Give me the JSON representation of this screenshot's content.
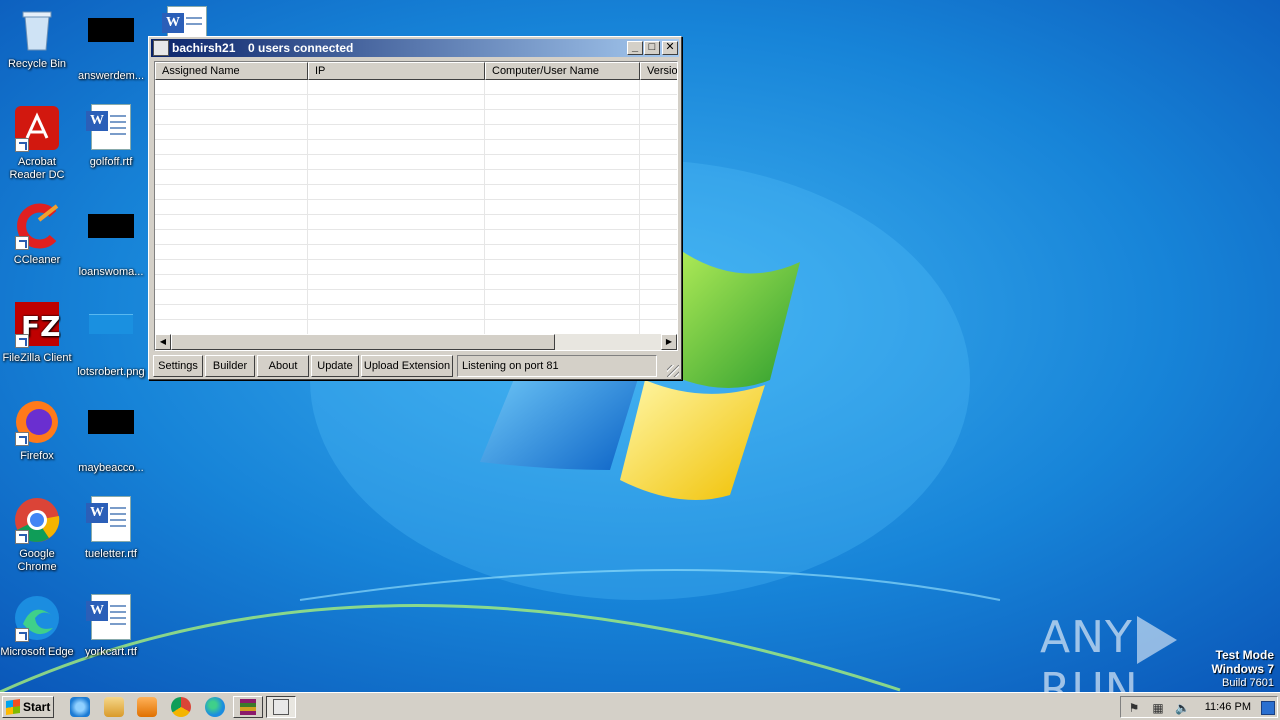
{
  "desktop": {
    "icons_col1": [
      {
        "label": "Recycle Bin",
        "icon": "recycle-bin-icon"
      },
      {
        "label": "Acrobat Reader DC",
        "icon": "acrobat-icon"
      },
      {
        "label": "CCleaner",
        "icon": "ccleaner-icon"
      },
      {
        "label": "FileZilla Client",
        "icon": "filezilla-icon"
      },
      {
        "label": "Firefox",
        "icon": "firefox-icon"
      },
      {
        "label": "Google Chrome",
        "icon": "chrome-icon"
      },
      {
        "label": "Microsoft Edge",
        "icon": "edge-icon"
      }
    ],
    "icons_col2": [
      {
        "label": "answerdem...",
        "icon": "black-thumbnail-icon"
      },
      {
        "label": "golfoff.rtf",
        "icon": "word-document-icon"
      },
      {
        "label": "loanswoma...",
        "icon": "black-thumbnail-icon"
      },
      {
        "label": "lotsrobert.png",
        "icon": "image-thumbnail-icon"
      },
      {
        "label": "maybeacco...",
        "icon": "black-thumbnail-icon"
      },
      {
        "label": "tueletter.rtf",
        "icon": "word-document-icon"
      },
      {
        "label": "yorkcart.rtf",
        "icon": "word-document-icon"
      }
    ]
  },
  "window": {
    "app_name": "bachirsh21",
    "status_title": "0 users connected",
    "controls": {
      "minimize": "_",
      "maximize": "□",
      "close": "✕"
    },
    "columns": [
      "Assigned Name",
      "IP",
      "Computer/User Name",
      "Versio"
    ],
    "buttons": {
      "settings": "Settings",
      "builder": "Builder",
      "about": "About",
      "update": "Update",
      "upload_extension": "Upload Extension"
    },
    "status_text": "Listening on port 81",
    "scroll": {
      "left": "◀",
      "right": "▶"
    }
  },
  "watermark": {
    "left": "ANY",
    "right": "RUN"
  },
  "os_notice": {
    "line1": "Test Mode",
    "line2": "Windows 7",
    "line3": "Build 7601"
  },
  "taskbar": {
    "start_label": "Start",
    "clock": "11:46 PM",
    "colors": {
      "ie": "#1c7bd4",
      "explorer": "#e8b84a",
      "media": "#f08a00",
      "chrome": "#db4437",
      "edge": "#1b8de0",
      "winrar": "#8b1a6b"
    }
  }
}
